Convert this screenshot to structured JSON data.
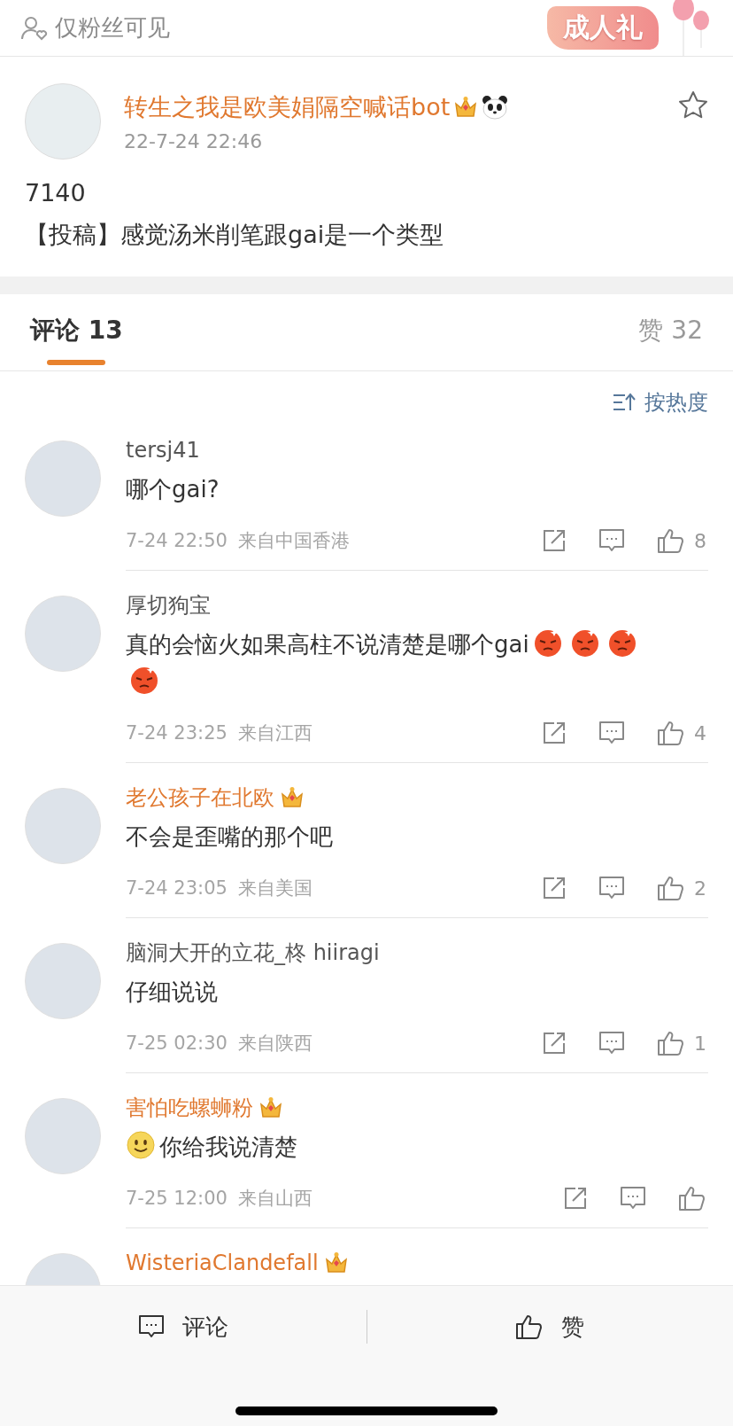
{
  "top_bar": {
    "visibility": "仅粉丝可见",
    "sticker": "成人礼"
  },
  "post": {
    "author": "转生之我是欧美娟隔空喊话bot",
    "vip": true,
    "panda": true,
    "time": "22-7-24 22:46",
    "lines": [
      "7140",
      "【投稿】感觉汤米削笔跟gai是一个类型"
    ]
  },
  "tabs": [
    {
      "label": "评论 13",
      "selected": true
    },
    {
      "label": "赞 32",
      "selected": false
    }
  ],
  "sort": "按热度",
  "comments": [
    {
      "name": "tersj41",
      "vip": false,
      "body": [
        {
          "kind": "text",
          "text": "哪个gai?"
        }
      ],
      "time": "7-24 22:50",
      "location": "来自中国香港",
      "likes": "8"
    },
    {
      "name": "厚切狗宝",
      "vip": false,
      "body": [
        {
          "kind": "text",
          "text": "真的会恼火如果高柱不说清楚是哪个gai"
        },
        {
          "kind": "angry"
        },
        {
          "kind": "angry"
        },
        {
          "kind": "angry"
        },
        {
          "kind": "angry"
        }
      ],
      "time": "7-24 23:25",
      "location": "来自江西",
      "likes": "4"
    },
    {
      "name": "老公孩子在北欧",
      "vip": true,
      "body": [
        {
          "kind": "text",
          "text": "不会是歪嘴的那个吧"
        }
      ],
      "time": "7-24 23:05",
      "location": "来自美国",
      "likes": "2"
    },
    {
      "name": "脑洞大开的立花_柊 hiiragi",
      "vip": false,
      "body": [
        {
          "kind": "text",
          "text": "仔细说说"
        }
      ],
      "time": "7-25 02:30",
      "location": "来自陕西",
      "likes": "1"
    },
    {
      "name": "害怕吃螺蛳粉",
      "vip": true,
      "body": [
        {
          "kind": "smile"
        },
        {
          "kind": "text",
          "text": "你给我说清楚"
        }
      ],
      "time": "7-25 12:00",
      "location": "来自山西"
    },
    {
      "name": "WisteriaClandefall",
      "vip": true
    }
  ],
  "bottom_bar": [
    {
      "kind": "comment",
      "label": "评论"
    },
    {
      "kind": "like",
      "label": "赞"
    }
  ]
}
